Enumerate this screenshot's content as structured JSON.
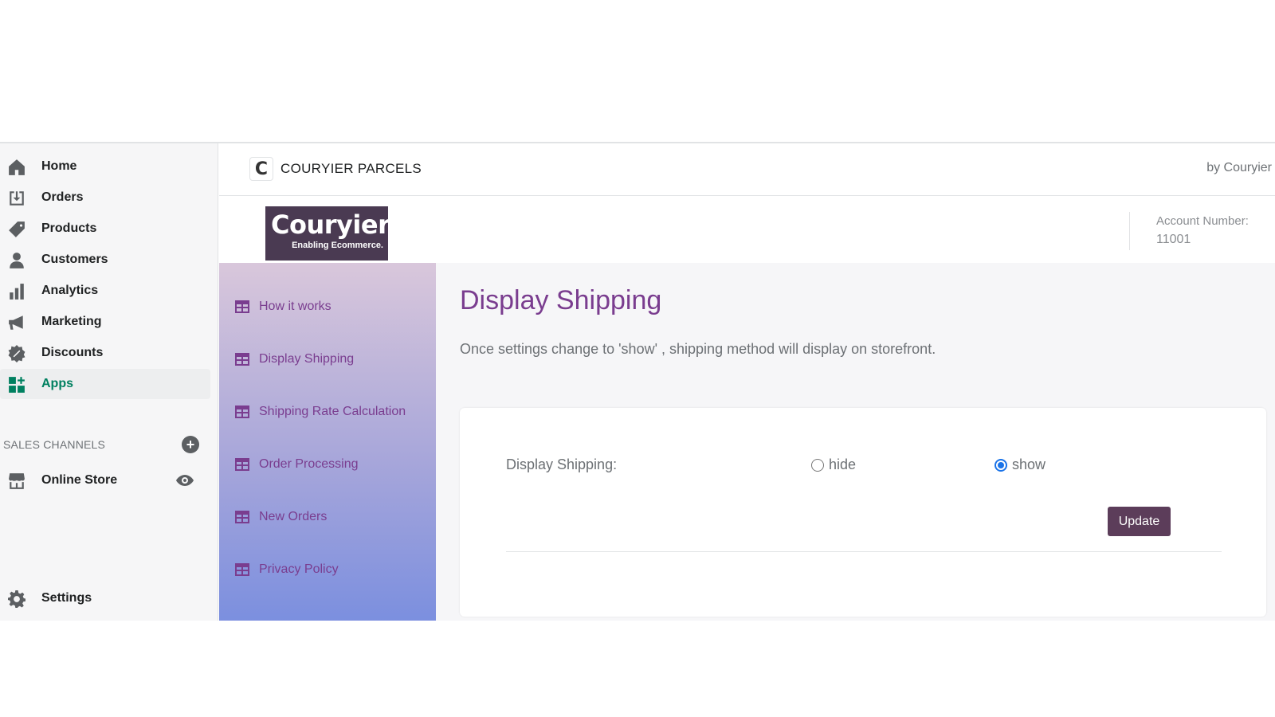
{
  "sidebar": {
    "items": [
      {
        "label": "Home",
        "icon": "home-icon"
      },
      {
        "label": "Orders",
        "icon": "orders-icon"
      },
      {
        "label": "Products",
        "icon": "tag-icon"
      },
      {
        "label": "Customers",
        "icon": "person-icon"
      },
      {
        "label": "Analytics",
        "icon": "bar-chart-icon"
      },
      {
        "label": "Marketing",
        "icon": "megaphone-icon"
      },
      {
        "label": "Discounts",
        "icon": "discount-icon"
      },
      {
        "label": "Apps",
        "icon": "apps-icon",
        "active": true
      }
    ],
    "sales_channels_heading": "SALES CHANNELS",
    "online_store_label": "Online Store",
    "settings_label": "Settings",
    "accent_color": "#008060"
  },
  "app": {
    "logo_letter": "C",
    "title": "COURYIER PARCELS",
    "by": "by Couryier",
    "brand": {
      "name": "Couryier",
      "tagline": "Enabling Ecommerce."
    },
    "account_label": "Account Number:",
    "account_number": "11001",
    "nav": [
      {
        "label": "How it works"
      },
      {
        "label": "Display Shipping"
      },
      {
        "label": "Shipping Rate Calculation"
      },
      {
        "label": "Order Processing"
      },
      {
        "label": "New Orders"
      },
      {
        "label": "Privacy Policy"
      }
    ],
    "accent_color": "#7a3d8f"
  },
  "main": {
    "title": "Display Shipping",
    "description": "Once settings change to 'show' , shipping method will display on storefront.",
    "form": {
      "label": "Display Shipping:",
      "options": [
        {
          "label": "hide",
          "selected": false
        },
        {
          "label": "show",
          "selected": true
        }
      ],
      "submit_label": "Update"
    }
  }
}
